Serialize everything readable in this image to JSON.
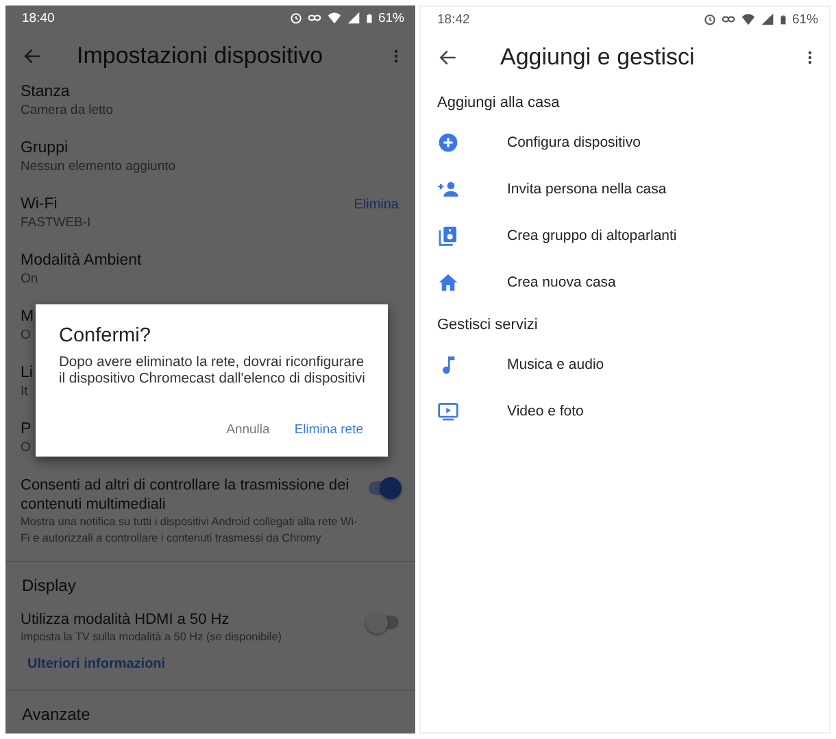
{
  "left_screen": {
    "status_bar": {
      "time": "18:40",
      "battery": "61%"
    },
    "app_bar": {
      "title": "Impostazioni dispositivo"
    },
    "settings": [
      {
        "kind": "item",
        "title": "Stanza",
        "subtitle": "Camera da letto"
      },
      {
        "kind": "item",
        "title": "Gruppi",
        "subtitle": "Nessun elemento aggiunto"
      },
      {
        "kind": "item",
        "title": "Wi-Fi",
        "subtitle": "FASTWEB-I",
        "action": "Elimina"
      },
      {
        "kind": "item",
        "title": "Modalità Ambient",
        "subtitle": "On"
      },
      {
        "kind": "item",
        "title": "M",
        "subtitle": "O"
      },
      {
        "kind": "item",
        "title": "Li",
        "subtitle": "It"
      },
      {
        "kind": "item",
        "title": "P",
        "subtitle": "O"
      },
      {
        "kind": "toggle",
        "title": "Consenti ad altri di controllare la trasmissione dei contenuti multimediali",
        "subtitle": "Mostra una notifica su tutti i dispositivi Android collegati alla rete Wi-Fi e autorizzali a controllare i contenuti trasmessi da Chromy",
        "on": true
      },
      {
        "kind": "header",
        "title": "Display"
      },
      {
        "kind": "toggle",
        "title": "Utilizza modalità HDMI a 50 Hz",
        "subtitle": "Imposta la TV sulla modalità a 50 Hz (se disponibile)",
        "on": false,
        "link": "Ulteriori informazioni"
      },
      {
        "kind": "header",
        "title": "Avanzate"
      }
    ],
    "dialog": {
      "title": "Confermi?",
      "message": "Dopo avere eliminato la rete, dovrai riconfigurare il dispositivo Chromecast dall'elenco di dispositivi",
      "buttons": [
        "Annulla",
        "Elimina rete"
      ]
    }
  },
  "right_screen": {
    "status_bar": {
      "time": "18:42",
      "battery": "61%"
    },
    "app_bar": {
      "title": "Aggiungi e gestisci"
    },
    "sections": [
      {
        "title": "Aggiungi alla casa",
        "items": [
          "Configura dispositivo",
          "Invita persona nella casa",
          "Crea gruppo di altoparlanti",
          "Crea nuova casa"
        ]
      },
      {
        "title": "Gestisci servizi",
        "items": [
          "Musica e audio",
          "Video e foto"
        ]
      }
    ]
  }
}
